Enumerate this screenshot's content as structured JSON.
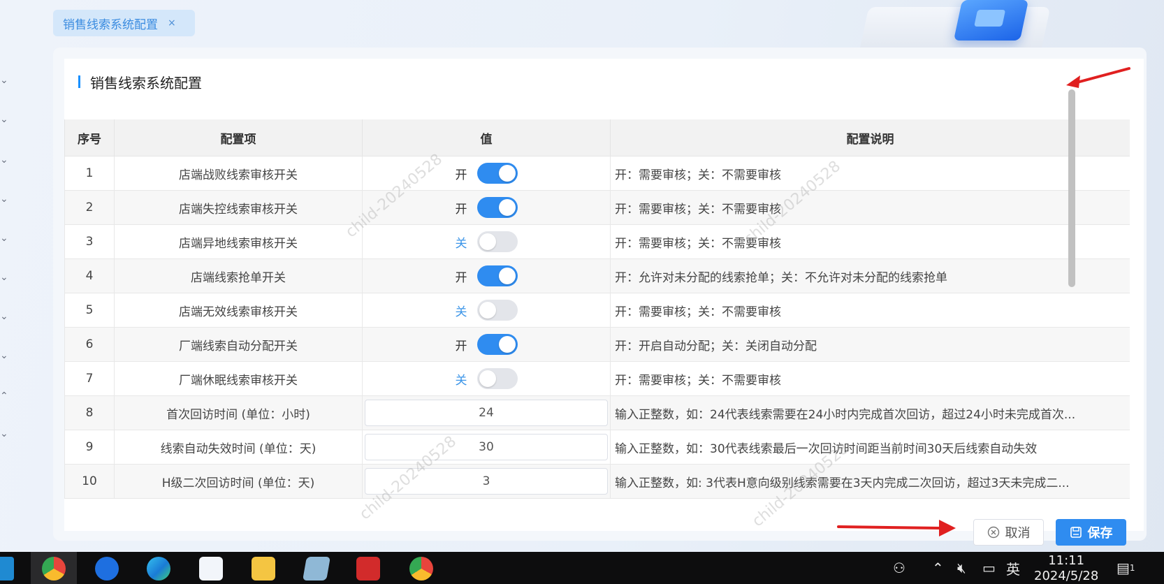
{
  "tab": {
    "label": "销售线索系统配置",
    "close": "×"
  },
  "card": {
    "title": "销售线索系统配置"
  },
  "table": {
    "headers": [
      "序号",
      "配置项",
      "值",
      "配置说明"
    ],
    "rows": [
      {
        "no": "1",
        "item": "店端战败线索审核开关",
        "type": "switch",
        "state": "on",
        "value_label": "开",
        "desc": "开：需要审核；关：不需要审核"
      },
      {
        "no": "2",
        "item": "店端失控线索审核开关",
        "type": "switch",
        "state": "on",
        "value_label": "开",
        "desc": "开：需要审核；关：不需要审核"
      },
      {
        "no": "3",
        "item": "店端异地线索审核开关",
        "type": "switch",
        "state": "off",
        "value_label": "关",
        "desc": "开：需要审核；关：不需要审核"
      },
      {
        "no": "4",
        "item": "店端线索抢单开关",
        "type": "switch",
        "state": "on",
        "value_label": "开",
        "desc": "开：允许对未分配的线索抢单；关：不允许对未分配的线索抢单"
      },
      {
        "no": "5",
        "item": "店端无效线索审核开关",
        "type": "switch",
        "state": "off",
        "value_label": "关",
        "desc": "开：需要审核；关：不需要审核"
      },
      {
        "no": "6",
        "item": "厂端线索自动分配开关",
        "type": "switch",
        "state": "on",
        "value_label": "开",
        "desc": "开：开启自动分配；关：关闭自动分配"
      },
      {
        "no": "7",
        "item": "厂端休眠线索审核开关",
        "type": "switch",
        "state": "off",
        "value_label": "关",
        "desc": "开：需要审核；关：不需要审核"
      },
      {
        "no": "8",
        "item": "首次回访时间 (单位：小时)",
        "type": "input",
        "value": "24",
        "desc": "输入正整数，如：24代表线索需要在24小时内完成首次回访，超过24小时未完成首次..."
      },
      {
        "no": "9",
        "item": "线索自动失效时间 (单位：天)",
        "type": "input",
        "value": "30",
        "desc": "输入正整数，如：30代表线索最后一次回访时间距当前时间30天后线索自动失效"
      },
      {
        "no": "10",
        "item": "H级二次回访时间 (单位：天)",
        "type": "input",
        "value": "3",
        "desc": "输入正整数，如: 3代表H意向级别线索需要在3天内完成二次回访，超过3天未完成二..."
      }
    ]
  },
  "footer": {
    "cancel_label": "取消",
    "save_label": "保存"
  },
  "watermark": "child-20240528",
  "taskbar": {
    "apps": [
      "vscode-icon",
      "chrome-icon",
      "maps-icon",
      "edge-icon",
      "download-icon",
      "folder-icon",
      "notepad-icon",
      "wps-icon",
      "chrome-icon"
    ],
    "ime": "英",
    "time": "11:11",
    "date": "2024/5/28",
    "notification_count": "1"
  },
  "colors": {
    "accent": "#2f8cf0",
    "annotation_arrow": "#e02020"
  }
}
